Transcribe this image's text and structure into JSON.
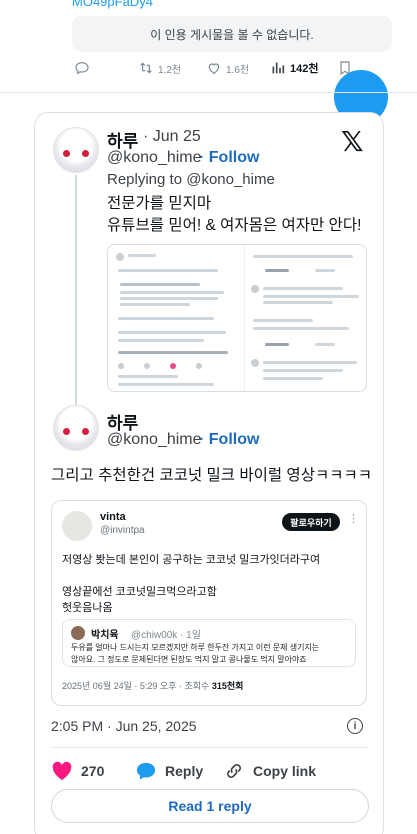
{
  "top": {
    "handle": "MO49pFaDy4",
    "unavailable_notice": "이 인용 게시물을 볼 수 없습니다.",
    "retweets": "1.2천",
    "likes": "1.6천",
    "views": "142천"
  },
  "embed": {
    "parent": {
      "display_name": "하루",
      "date": "· Jun 25",
      "handle": "@kono_hime",
      "follow_label": "· Follow",
      "replying_to": "Replying to @kono_hime",
      "text_line1": "전문가를 믿지마",
      "text_line2": "유튜브를 믿어! & 여자몸은 여자만 안다!"
    },
    "reply": {
      "display_name": "하루",
      "handle": "@kono_hime",
      "follow_label": "· Follow",
      "text": "그리고 추천한건 코코넛 밀크 바이럴 영상ㅋㅋㅋㅋ"
    },
    "quote": {
      "name": "vinta",
      "handle": "@invintpa",
      "follow_label": "팔로우하기",
      "line1": "저영상 봣는데 본인이 공구하는 코코넛 밀크가잇더라구여",
      "line2": "영상끝에선 코코넛밀크먹으라고함",
      "line3": "헛웃음나옴",
      "inner_name": "박치육",
      "inner_handle": "@chiw00k · 1일",
      "inner_line1": "두유를 얼마나 드시는지 모르겠지만 하루 한두잔 가지고 이런 문제 생기지는",
      "inner_line2": "않아요. 그 정도로 문제된다면 된장도 먹지 말고 콩나물도 먹지 말아야죠",
      "date_text": "2025년 06월 24일 · 5:29 오후 · 조회수 ",
      "views": "315천회"
    },
    "timestamp": "2:05 PM · Jun 25, 2025",
    "info_glyph": "i",
    "likes": "270",
    "reply_label": "Reply",
    "copy_link_label": "Copy link",
    "read_replies_label": "Read 1 reply",
    "brand_glyph": "𝕏",
    "colors": {
      "like": "#f91880",
      "reply": "#1d9bf0",
      "link": "#1d6bc0"
    }
  }
}
